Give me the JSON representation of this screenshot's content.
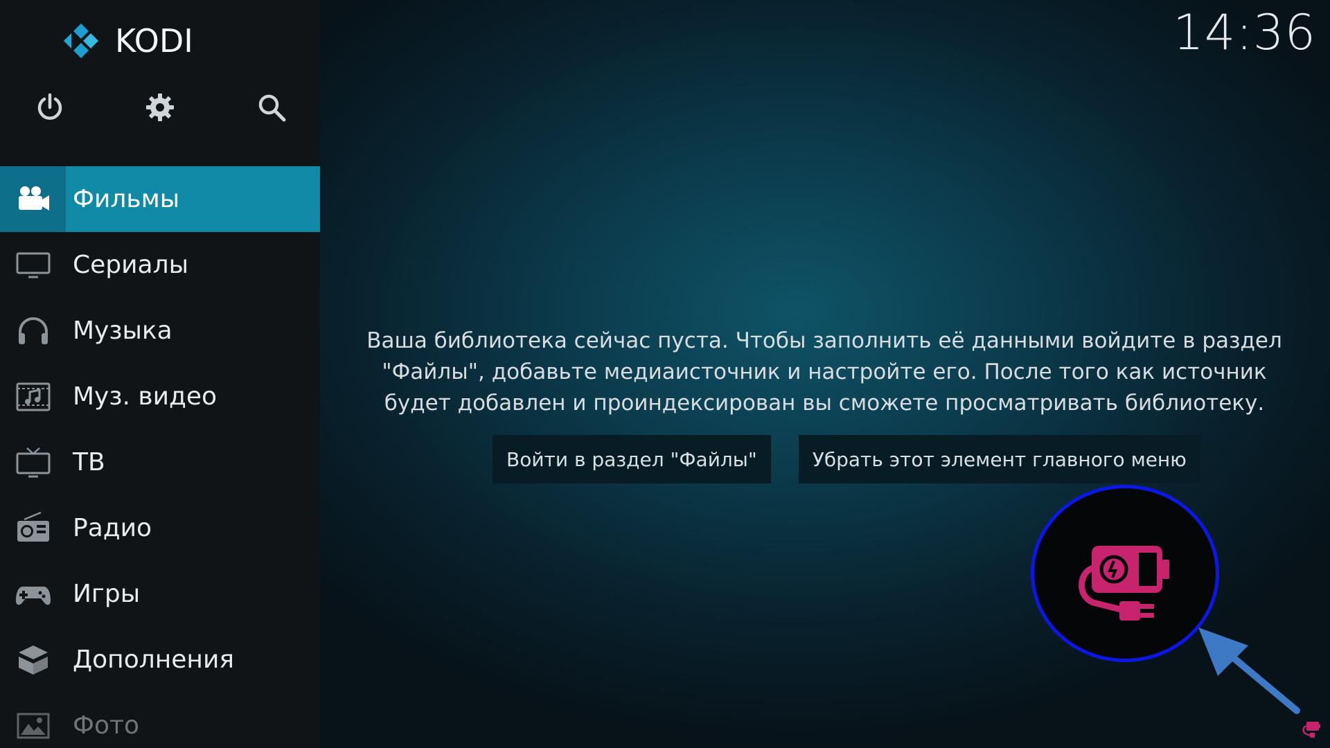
{
  "app": {
    "logo_text": "KODI"
  },
  "clock": "14:36",
  "top_icons": [
    "power-icon",
    "gear-icon",
    "search-icon"
  ],
  "sidebar": {
    "items": [
      {
        "label": "Фильмы",
        "icon": "movies-camera-icon",
        "state": "active"
      },
      {
        "label": "Сериалы",
        "icon": "tv-monitor-icon",
        "state": "normal"
      },
      {
        "label": "Музыка",
        "icon": "headphones-icon",
        "state": "normal"
      },
      {
        "label": "Муз. видео",
        "icon": "music-video-icon",
        "state": "normal"
      },
      {
        "label": "ТВ",
        "icon": "tv-icon",
        "state": "normal"
      },
      {
        "label": "Радио",
        "icon": "radio-icon",
        "state": "normal"
      },
      {
        "label": "Игры",
        "icon": "gamepad-icon",
        "state": "normal"
      },
      {
        "label": "Дополнения",
        "icon": "addons-box-icon",
        "state": "normal"
      },
      {
        "label": "Фото",
        "icon": "photo-icon",
        "state": "dim"
      }
    ]
  },
  "main": {
    "message": "Ваша библиотека сейчас пуста. Чтобы заполнить её данными войдите в раздел \"Файлы\", добавьте медиаисточник и настройте его. После того как источник будет добавлен и проиндексирован вы сможете просматривать библиотеку.",
    "buttons": {
      "files": "Войти в раздел \"Файлы\"",
      "remove": "Убрать этот элемент главного меню"
    }
  },
  "colors": {
    "accent": "#118aa8",
    "accent_dark": "#0e6f8a",
    "sidebar_bg": "#101416",
    "highlight_circle": "#0b17e6",
    "arrow": "#3d79c4",
    "plug_icon": "#c8246e"
  },
  "annotation": {
    "icon": "battery-plug-icon",
    "pointer": "arrow-pointer"
  }
}
